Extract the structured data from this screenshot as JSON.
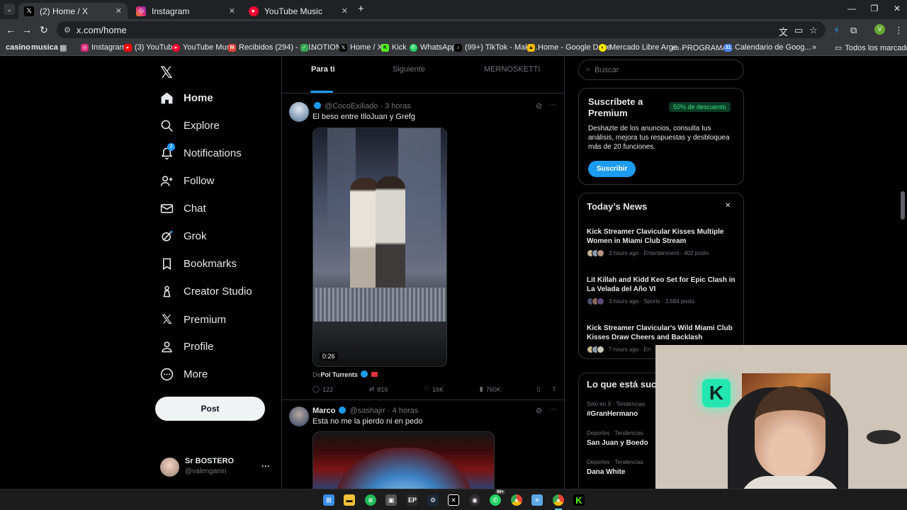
{
  "browser": {
    "tabs": [
      {
        "title": "(2) Home / X",
        "icon": "x-logo-icon"
      },
      {
        "title": "Instagram",
        "icon": "instagram-icon"
      },
      {
        "title": "YouTube Music",
        "icon": "youtube-music-icon"
      }
    ],
    "url": "x.com/home",
    "profile_initial": "V",
    "bookmarks": [
      "casino",
      "musica",
      "Instagram",
      "(3) YouTube",
      "YouTube Music",
      "Recibidos (294) - val...",
      "NOTION",
      "Home / X",
      "Kick",
      "WhatsApp",
      "(99+) TikTok - Make...",
      "Home - Google Drive",
      "Mercado Libre Arge...",
      "PROGRAMAS",
      "Calendario de Goog..."
    ],
    "all_bookmarks": "Todos los marcadores"
  },
  "nav": {
    "items": [
      "Home",
      "Explore",
      "Notifications",
      "Follow",
      "Chat",
      "Grok",
      "Bookmarks",
      "Creator Studio",
      "Premium",
      "Profile",
      "More"
    ],
    "notifications_badge": "2",
    "post_label": "Post",
    "account": {
      "name": "Sr BOSTERO",
      "handle": "@valenganin",
      "more": "···"
    }
  },
  "feed": {
    "tabs": [
      "Para ti",
      "Siguiente",
      "MERNOSKETTI"
    ],
    "posts": [
      {
        "handle": "@CocoExiliado",
        "time": "3 horas",
        "text": "El beso entre IlloJuan y Grefg",
        "video_duration": "0:26",
        "from_prefix": "De",
        "from_name": "Pol Turrents",
        "replies": "122",
        "reposts": "816",
        "likes": "16K",
        "views": "760K"
      },
      {
        "name": "Marco",
        "handle": "@sashajrr",
        "time": "4 horas",
        "text": "Esta no me la pierdo ni en pedo"
      }
    ]
  },
  "sidebar": {
    "search_placeholder": "Buscar",
    "premium": {
      "title": "Suscríbete a Premium",
      "badge": "50% de descuento",
      "body": "Deshazte de los anuncios, consulta tus análisis, mejora tus respuestas y desbloquea más de 20 funciones.",
      "button": "Suscribir"
    },
    "news": {
      "title": "Today’s News",
      "close": "✕",
      "items": [
        {
          "title": "Kick Streamer Clavicular Kisses Multiple Women in Miami Club Stream",
          "meta": "3 hours ago · Entertainment · 402 posts"
        },
        {
          "title": "Lit Killah and Kidd Keo Set for Epic Clash in La Velada del Año VI",
          "meta": "3 hours ago · Sports · 3,684 posts"
        },
        {
          "title": "Kick Streamer Clavicular's Wild Miami Club Kisses Draw Cheers and Backlash",
          "meta": "7 hours ago · En"
        }
      ]
    },
    "trends": {
      "title": "Lo que está suc",
      "items": [
        {
          "category": "Sólo en X · Tendencias",
          "name": "#GranHermano"
        },
        {
          "category": "Deportes · Tendencias",
          "name": "San Juan y Boedo"
        },
        {
          "category": "Deportes · Tendencias",
          "name": "Dana White"
        }
      ]
    }
  },
  "taskbar": {
    "whatsapp_badge": "99+"
  }
}
